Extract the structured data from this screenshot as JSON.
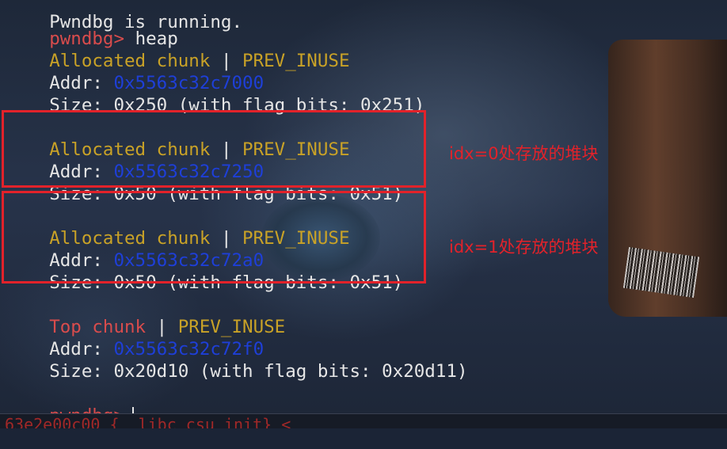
{
  "terminal": {
    "top_line": "Pwndbg is running.",
    "prompt": "pwndbg>",
    "command": "heap",
    "chunks": [
      {
        "title_a": "Allocated chunk",
        "sep": "|",
        "title_b": "PREV_INUSE",
        "addr_label": "Addr:",
        "addr": "0x5563c32c7000",
        "size_line": "Size: 0x250 (with flag bits: 0x251)"
      },
      {
        "title_a": "Allocated chunk",
        "sep": "|",
        "title_b": "PREV_INUSE",
        "addr_label": "Addr:",
        "addr": "0x5563c32c7250",
        "size_line": "Size: 0x50 (with flag bits: 0x51)"
      },
      {
        "title_a": "Allocated chunk",
        "sep": "|",
        "title_b": "PREV_INUSE",
        "addr_label": "Addr:",
        "addr": "0x5563c32c72a0",
        "size_line": "Size: 0x50 (with flag bits: 0x51)"
      },
      {
        "title_a": "Top chunk",
        "sep": "|",
        "title_b": "PREV_INUSE",
        "addr_label": "Addr:",
        "addr": "0x5563c32c72f0",
        "size_line": "Size: 0x20d10 (with flag bits: 0x20d11)"
      }
    ],
    "final_prompt": "pwndbg>",
    "bottom_line": "63e2e00c00 {__libc_csu_init} <"
  },
  "annotations": {
    "idx0": "idx=0处存放的堆块",
    "idx1": "idx=1处存放的堆块"
  },
  "colors": {
    "prompt": "#d94c4c",
    "chunk_title": "#c9a227",
    "address": "#1e3fd8",
    "text": "#e6e6e6",
    "highlight_box": "#e2222a"
  }
}
